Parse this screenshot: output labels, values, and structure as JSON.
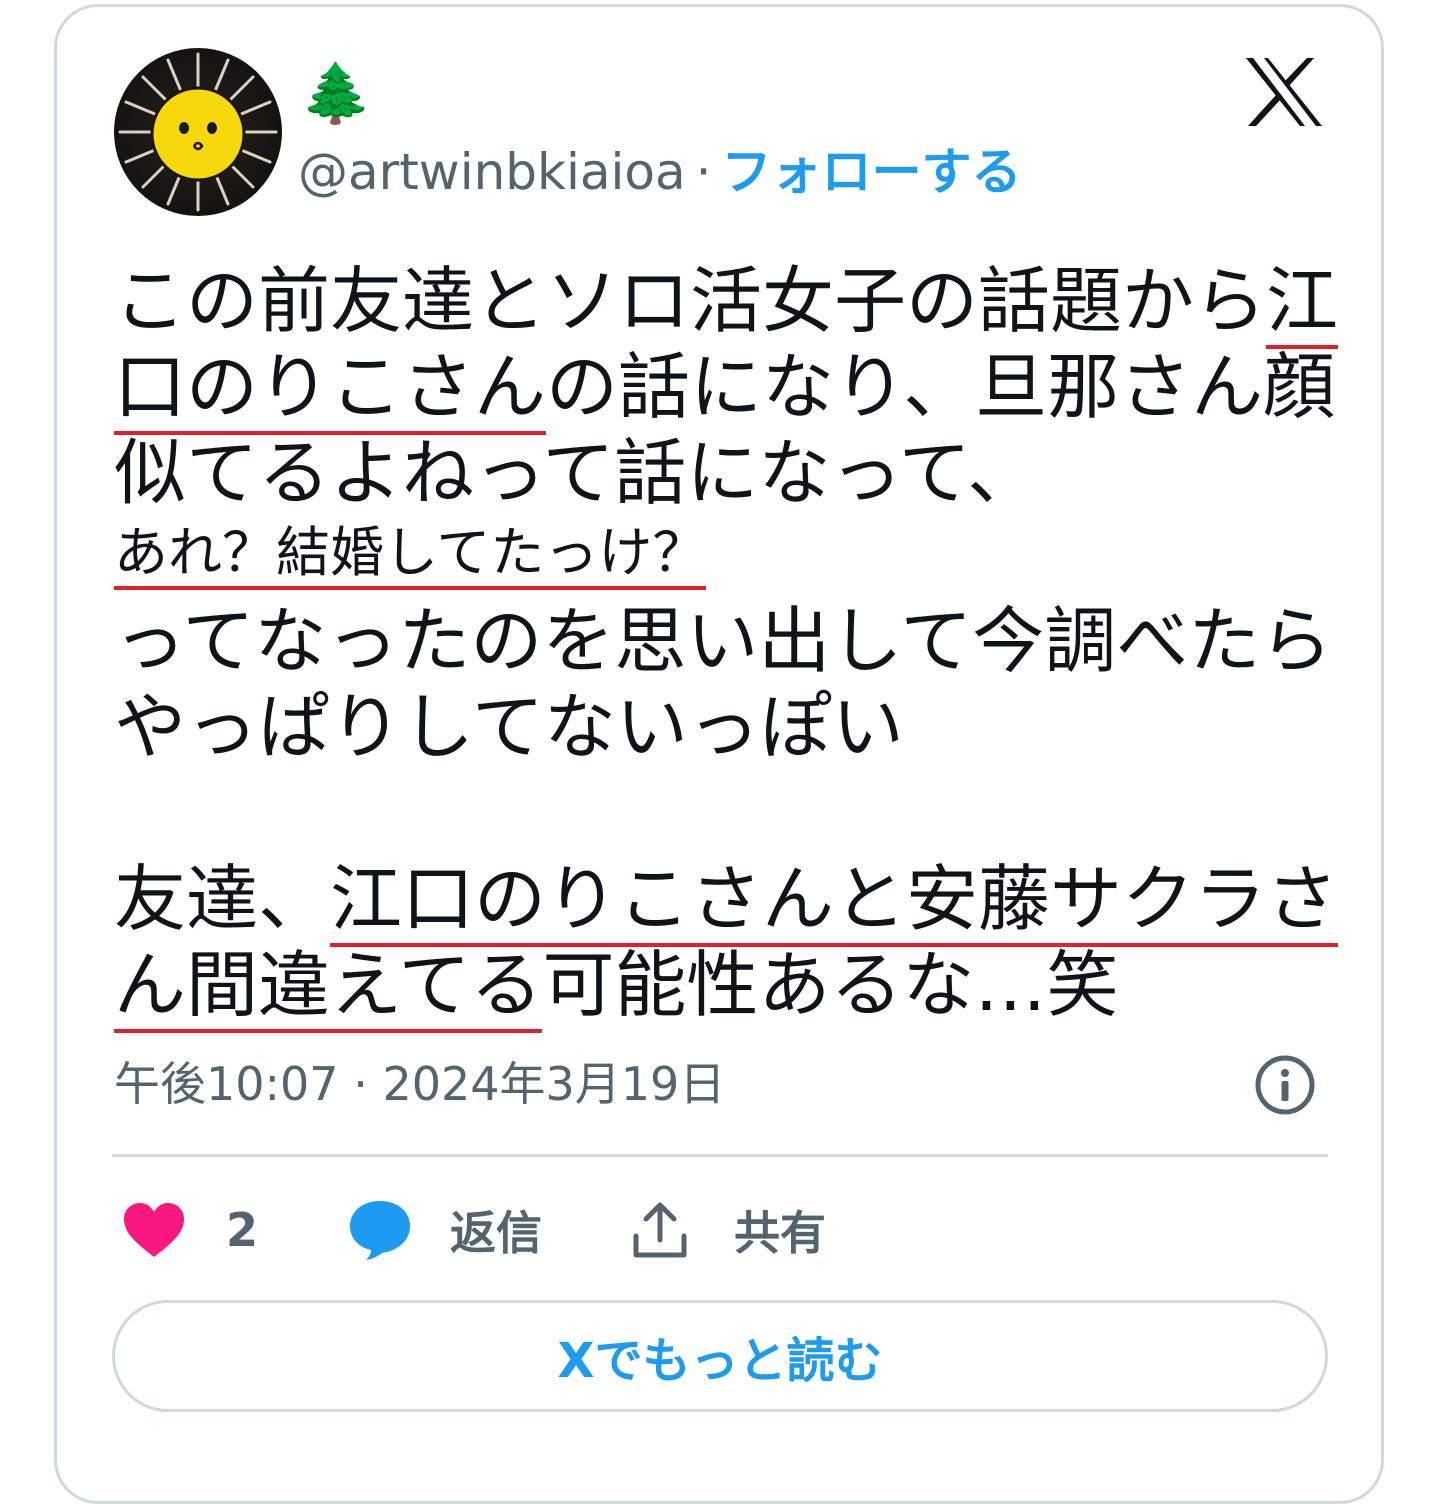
{
  "author": {
    "display_name": "🌲",
    "handle": "@artwinbkiaioa",
    "separator": "·",
    "follow_label": "フォローする"
  },
  "tweet": {
    "line1_a": "この前友達とソロ活女子の話題から",
    "line1_b": "江",
    "line2_a": "口のりこさん",
    "line2_b": "の話になり、旦那さん顔",
    "line3": "似てるよねって話になって、",
    "line4": "あれ？結婚してたっけ？",
    "line5": "ってなったのを思い出して今調べたら",
    "line6": "やっぱりしてないっぽい",
    "line7_a": "友達、",
    "line7_b": "江口のりこさんと安藤サクラさ",
    "line8_a": "ん間違えてる",
    "line8_b": "可能性あるな…笑"
  },
  "meta": {
    "time": "午後10:07",
    "separator": "·",
    "date": "2024年3月19日"
  },
  "actions": {
    "like_count": "2",
    "reply_label": "返信",
    "share_label": "共有"
  },
  "read_more_label": "Xでもっと読む",
  "colors": {
    "accent": "#1d9bf0",
    "like": "#f91880",
    "underline": "#e0202b",
    "secondary_text": "#536471",
    "border": "#cfd9de"
  },
  "icons": {
    "brand": "x-logo-icon",
    "info": "info-icon",
    "like": "heart-icon",
    "reply": "speech-bubble-icon",
    "share": "share-upload-icon"
  }
}
